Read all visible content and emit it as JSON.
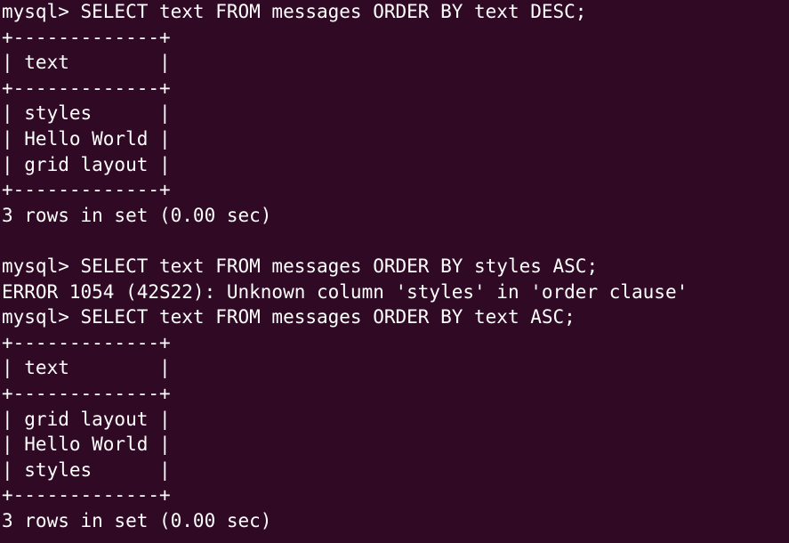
{
  "terminal": {
    "colors": {
      "background": "#300a24",
      "foreground": "#ffffff"
    },
    "lines": [
      "mysql> SELECT text FROM messages ORDER BY text DESC;",
      "+-------------+",
      "| text        |",
      "+-------------+",
      "| styles      |",
      "| Hello World |",
      "| grid layout |",
      "+-------------+",
      "3 rows in set (0.00 sec)",
      "",
      "mysql> SELECT text FROM messages ORDER BY styles ASC;",
      "ERROR 1054 (42S22): Unknown column 'styles' in 'order clause'",
      "mysql> SELECT text FROM messages ORDER BY text ASC;",
      "+-------------+",
      "| text        |",
      "+-------------+",
      "| grid layout |",
      "| Hello World |",
      "| styles      |",
      "+-------------+",
      "3 rows in set (0.00 sec)"
    ]
  }
}
